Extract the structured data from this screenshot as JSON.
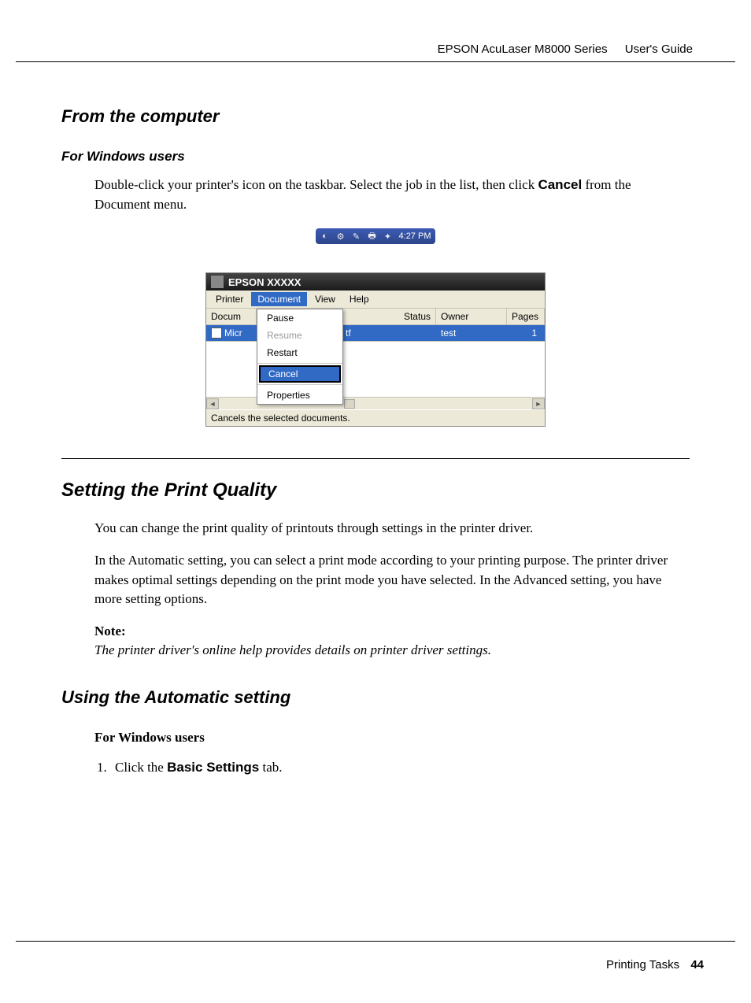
{
  "header": {
    "product": "EPSON AcuLaser M8000 Series",
    "doc": "User's Guide"
  },
  "section1": {
    "title": "From the computer",
    "sub": "For Windows users",
    "para_pre": "Double-click your printer's icon on the taskbar. Select the job in the list, then click ",
    "para_bold": "Cancel",
    "para_post": " from the Document menu."
  },
  "tray": {
    "time": "4:27 PM"
  },
  "queue": {
    "title": "EPSON XXXXX",
    "menus": [
      "Printer",
      "Document",
      "View",
      "Help"
    ],
    "active_menu_index": 1,
    "columns_left": "Docum",
    "columns": [
      "Status",
      "Owner",
      "Pages"
    ],
    "row": {
      "doc_label": "Micr",
      "rtf": "tf",
      "owner": "test",
      "pages": "1"
    },
    "dropdown": {
      "items": [
        {
          "label": "Pause",
          "state": "normal"
        },
        {
          "label": "Resume",
          "state": "disabled"
        },
        {
          "label": "Restart",
          "state": "normal"
        },
        {
          "sep": true
        },
        {
          "label": "Cancel",
          "state": "highlight"
        },
        {
          "sep": true
        },
        {
          "label": "Properties",
          "state": "normal"
        }
      ]
    },
    "status": "Cancels the selected documents."
  },
  "section2": {
    "title": "Setting the Print Quality",
    "p1": "You can change the print quality of printouts through settings in the printer driver.",
    "p2": "In the Automatic setting, you can select a print mode according to your printing purpose. The printer driver makes optimal settings depending on the print mode you have selected. In the Advanced setting, you have more setting options.",
    "note_label": "Note:",
    "note_body": "The printer driver's online help provides details on printer driver settings."
  },
  "section3": {
    "title": "Using the Automatic setting",
    "sub": "For Windows users",
    "step_pre": "Click the ",
    "step_bold": "Basic Settings",
    "step_post": " tab."
  },
  "footer": {
    "chapter": "Printing Tasks",
    "page": "44"
  }
}
